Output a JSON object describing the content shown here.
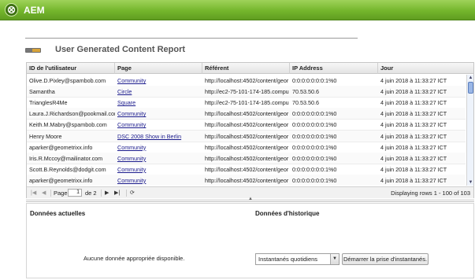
{
  "app": {
    "brand": "AEM"
  },
  "report": {
    "title": "User Generated Content Report"
  },
  "columns": [
    "ID de l'utilisateur",
    "Page",
    "Référent",
    "IP Address",
    "Jour"
  ],
  "rows": [
    {
      "user": "Olive.D.Pixley@spambob.com",
      "page": "Community",
      "referrer": "http://localhost:4502/content/geor",
      "ip": "0:0:0:0:0:0:0:1%0",
      "date": "4 juin 2018 à 11:33:27 ICT"
    },
    {
      "user": "Samantha",
      "page": "Circle",
      "referrer": "http://ec2-75-101-174-185.compu",
      "ip": "70.53.50.6",
      "date": "4 juin 2018 à 11:33:27 ICT"
    },
    {
      "user": "TrianglesR4Me",
      "page": "Square",
      "referrer": "http://ec2-75-101-174-185.compu",
      "ip": "70.53.50.6",
      "date": "4 juin 2018 à 11:33:27 ICT"
    },
    {
      "user": "Laura.J.Richardson@pookmail.com",
      "page": "Community",
      "referrer": "http://localhost:4502/content/geor",
      "ip": "0:0:0:0:0:0:0:1%0",
      "date": "4 juin 2018 à 11:33:27 ICT"
    },
    {
      "user": "Keith.M.Mabry@spambob.com",
      "page": "Community",
      "referrer": "http://localhost:4502/content/geor",
      "ip": "0:0:0:0:0:0:0:1%0",
      "date": "4 juin 2018 à 11:33:27 ICT"
    },
    {
      "user": "Henry Moore",
      "page": "DSC 2008 Show in Berlin",
      "referrer": "http://localhost:4502/content/geor",
      "ip": "0:0:0:0:0:0:0:1%0",
      "date": "4 juin 2018 à 11:33:27 ICT"
    },
    {
      "user": "aparker@geometrixx.info",
      "page": "Community",
      "referrer": "http://localhost:4502/content/geor",
      "ip": "0:0:0:0:0:0:0:1%0",
      "date": "4 juin 2018 à 11:33:27 ICT"
    },
    {
      "user": "Iris.R.Mccoy@mailinator.com",
      "page": "Community",
      "referrer": "http://localhost:4502/content/geor",
      "ip": "0:0:0:0:0:0:0:1%0",
      "date": "4 juin 2018 à 11:33:27 ICT"
    },
    {
      "user": "Scott.B.Reynolds@dodgit.com",
      "page": "Community",
      "referrer": "http://localhost:4502/content/geor",
      "ip": "0:0:0:0:0:0:0:1%0",
      "date": "4 juin 2018 à 11:33:27 ICT"
    },
    {
      "user": "aparker@geometrixx.info",
      "page": "Community",
      "referrer": "http://localhost:4502/content/geor",
      "ip": "0:0:0:0:0:0:0:1%0",
      "date": "4 juin 2018 à 11:33:27 ICT"
    }
  ],
  "pager": {
    "page_label": "Page",
    "page_value": "1",
    "of_label": "de 2",
    "displaying": "Displaying rows 1 - 100 of 103"
  },
  "current_data": {
    "title": "Données actuelles",
    "empty_message": "Aucune donnée appropriée disponible."
  },
  "history": {
    "title": "Données d'historique",
    "select_value": "Instantanés quotidiens",
    "start_button": "Démarrer la prise d'instantanés."
  },
  "icons": {
    "logo": "aem-logo-icon",
    "first": "first-page-icon",
    "prev": "prev-page-icon",
    "next": "next-page-icon",
    "last": "last-page-icon",
    "refresh": "refresh-icon",
    "dropdown": "chevron-down-icon"
  },
  "colors": {
    "topbar": "#74b62c",
    "link": "#1a1a8c",
    "scroll_thumb": "#9bb7e6"
  }
}
